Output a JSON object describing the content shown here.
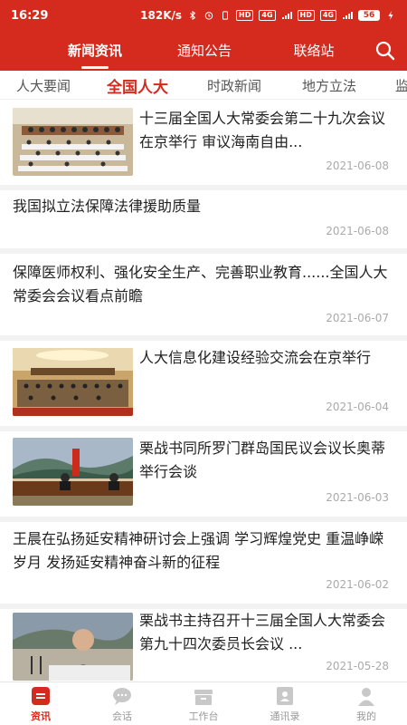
{
  "status_bar": {
    "time": "16:29",
    "speed": "182K/s",
    "hd1": "HD",
    "net1": "4G",
    "hd2": "HD",
    "net2": "4G",
    "battery": "56"
  },
  "top_nav": {
    "tabs": [
      {
        "label": "新闻资讯",
        "active": true
      },
      {
        "label": "通知公告",
        "active": false
      },
      {
        "label": "联络站",
        "active": false
      }
    ]
  },
  "categories": [
    {
      "label": "人大要闻",
      "active": false
    },
    {
      "label": "全国人大",
      "active": true
    },
    {
      "label": "时政新闻",
      "active": false
    },
    {
      "label": "地方立法",
      "active": false
    },
    {
      "label": "监",
      "active": false
    }
  ],
  "news": [
    {
      "title": "十三届全国人大常委会第二十九次会议在京举行 审议海南自由...",
      "date": "2021-06-08",
      "has_image": true,
      "icon": "meeting-hall-photo"
    },
    {
      "title": "我国拟立法保障法律援助质量",
      "date": "2021-06-08",
      "has_image": false
    },
    {
      "title": "保障医师权利、强化安全生产、完善职业教育......全国人大常委会会议看点前瞻",
      "date": "2021-06-07",
      "has_image": false
    },
    {
      "title": "人大信息化建设经验交流会在京举行",
      "date": "2021-06-04",
      "has_image": true,
      "icon": "conference-photo"
    },
    {
      "title": "栗战书同所罗门群岛国民议会议长奥蒂举行会谈",
      "date": "2021-06-03",
      "has_image": true,
      "icon": "video-talk-photo"
    },
    {
      "title": "王晨在弘扬延安精神研讨会上强调 学习辉煌党史 重温峥嵘岁月 发扬延安精神奋斗新的征程",
      "date": "2021-06-02",
      "has_image": false
    },
    {
      "title": "栗战书主持召开十三届全国人大常委会第九十四次委员长会议 ...",
      "date": "2021-05-28",
      "has_image": true,
      "icon": "speaker-photo"
    }
  ],
  "bottom_nav": [
    {
      "label": "资讯",
      "icon": "news-icon",
      "active": true
    },
    {
      "label": "会话",
      "icon": "chat-icon",
      "active": false
    },
    {
      "label": "工作台",
      "icon": "workbench-icon",
      "active": false
    },
    {
      "label": "通讯录",
      "icon": "contacts-icon",
      "active": false
    },
    {
      "label": "我的",
      "icon": "profile-icon",
      "active": false
    }
  ],
  "colors": {
    "accent": "#d52b1e",
    "date": "#aaaaaa",
    "inactive": "#999999"
  }
}
